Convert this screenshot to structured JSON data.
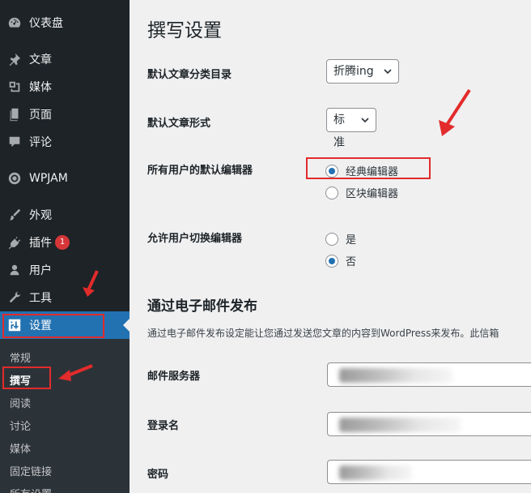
{
  "sidebar": {
    "dashboard": "仪表盘",
    "posts": "文章",
    "media": "媒体",
    "pages": "页面",
    "comments": "评论",
    "wpjam": "WPJAM",
    "appearance": "外观",
    "plugins": "插件",
    "plugins_badge": "1",
    "users": "用户",
    "tools": "工具",
    "settings": "设置"
  },
  "submenu": {
    "general": "常规",
    "writing": "撰写",
    "reading": "阅读",
    "discussion": "讨论",
    "media": "媒体",
    "permalinks": "固定链接",
    "privacy": "所有设置"
  },
  "page": {
    "title": "撰写设置",
    "default_category_label": "默认文章分类目录",
    "default_category_value": "折腾ing",
    "default_format_label": "默认文章形式",
    "default_format_value": "标准",
    "editor_label": "所有用户的默认编辑器",
    "editor_classic": "经典编辑器",
    "editor_block": "区块编辑器",
    "switch_label": "允许用户切换编辑器",
    "switch_yes": "是",
    "switch_no": "否",
    "email_section_title": "通过电子邮件发布",
    "email_section_desc": "通过电子邮件发布设定能让您通过发送您文章的内容到WordPress来发布。此信箱",
    "mail_server_label": "邮件服务器",
    "login_label": "登录名",
    "password_label": "密码"
  },
  "colors": {
    "sidebar_bg": "#1d2327",
    "accent": "#2271b1",
    "highlight_red": "#e22b2b"
  }
}
